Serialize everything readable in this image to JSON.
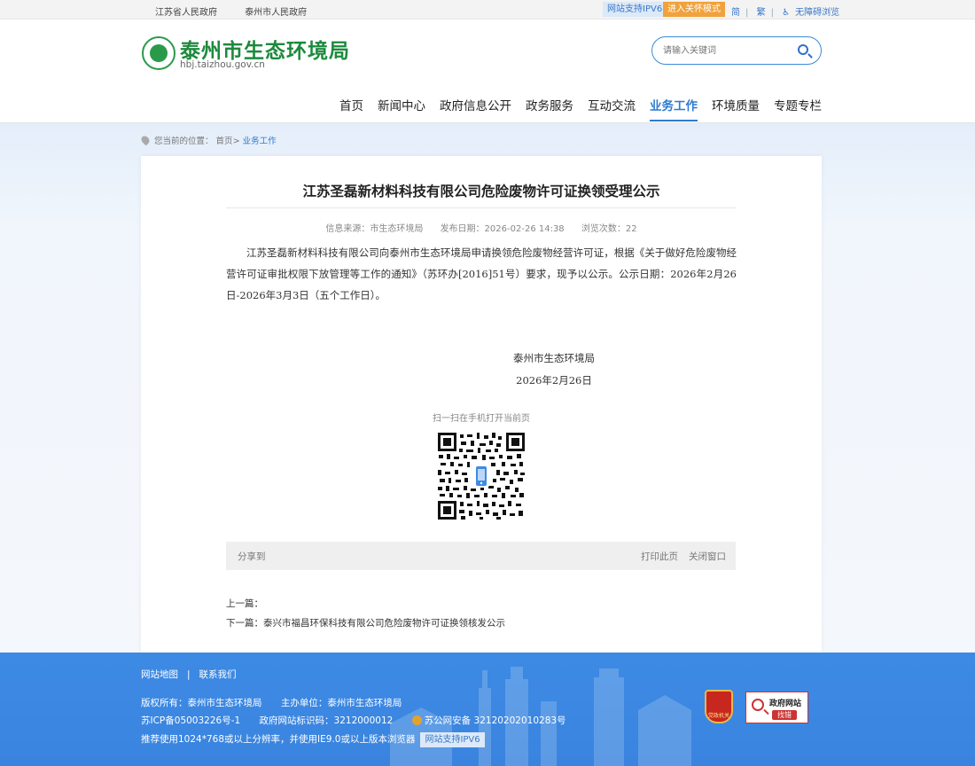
{
  "topbar": {
    "link_province": "江苏省人民政府",
    "link_city": "泰州市人民政府",
    "ipv6": "网站支持IPV6",
    "care_mode": "进入关怀模式",
    "simplified": "简",
    "traditional": "繁",
    "accessible": "无障碍浏览"
  },
  "header": {
    "site_name": "泰州市生态环境局",
    "domain": "hbj.taizhou.gov.cn",
    "search_placeholder": "请输入关键词"
  },
  "nav": [
    "首页",
    "新闻中心",
    "政府信息公开",
    "政务服务",
    "互动交流",
    "业务工作",
    "环境质量",
    "专题专栏"
  ],
  "nav_active_index": 5,
  "breadcrumb": {
    "prefix": "您当前的位置：",
    "home": "首页",
    "arrow": ">",
    "current": "业务工作"
  },
  "article": {
    "title": "江苏圣磊新材料科技有限公司危险废物许可证换领受理公示",
    "source": "信息来源：市生态环境局",
    "date": "发布日期：2026-02-26 14:38",
    "views": "浏览次数：22",
    "body": "江苏圣磊新材料科技有限公司向泰州市生态环境局申请换领危险废物经营许可证，根据《关于做好危险废物经营许可证审批权限下放管理等工作的通知》（苏环办[2016]51号）要求，现予以公示。公示日期：2026年2月26日-2026年3月3日（五个工作日）。",
    "sign_org": "泰州市生态环境局",
    "sign_date": "2026年2月26日",
    "qr_label": "扫一扫在手机打开当前页",
    "share": "分享到",
    "print": "打印此页",
    "close": "关闭窗口",
    "prev": "上一篇：",
    "next": "下一篇：泰兴市福昌环保科技有限公司危险废物许可证换领核发公示"
  },
  "footer": {
    "sitemap": "网站地图",
    "sep": "|",
    "contact": "联系我们",
    "copyright": "版权所有：泰州市生态环境局",
    "sponsor": "主办单位：泰州市生态环境局",
    "icp": "苏ICP备05003226号-1",
    "site_code": "政府网站标识码：3212000012",
    "police": "苏公网安备 32120202010283号",
    "resolution": "推荐使用1024*768或以上分辨率，并使用IE9.0或以上版本浏览器",
    "ipv6": "网站支持IPV6",
    "party_badge": "党政机关",
    "gov_badge_title": "政府网站",
    "gov_badge_sub": "找错"
  },
  "colors": {
    "brand_green": "#1c8a3c",
    "accent_blue": "#2f7ad2",
    "footer_blue": "#3d8ae4",
    "care_orange": "#f0a23c"
  }
}
